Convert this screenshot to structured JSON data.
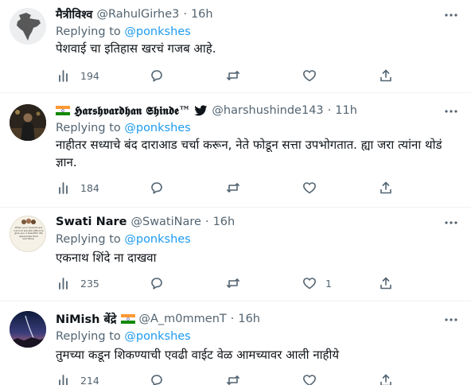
{
  "tweets": [
    {
      "display_name": "मैत्रीविश्व",
      "handle": "@RahulGirhe3",
      "separator": "·",
      "time": "16h",
      "replying_prefix": "Replying to",
      "replying_to": "@ponkshes",
      "text": "पेशवाई चा इतिहास खरचं गजब आहे.",
      "stats": {
        "replies": "",
        "retweets": "",
        "likes": "",
        "views": "194"
      }
    },
    {
      "display_name": "𝕳𝖆𝖗𝖘𝖍𝖛𝖆𝖗𝖉𝖍𝖆𝖓 𝕾𝖍𝖎𝖓𝖉𝖊™",
      "handle": "@harshushinde143",
      "separator": "·",
      "time": "11h",
      "replying_prefix": "Replying to",
      "replying_to": "@ponkshes",
      "text": "नाहीतर सध्याचे बंद दाराआड चर्चा करून, नेते फोडून सत्ता उपभोगतात. ह्या जरा त्यांना थोडं ज्ञान.",
      "stats": {
        "replies": "",
        "retweets": "",
        "likes": "",
        "views": "184"
      }
    },
    {
      "display_name": "Swati Nare",
      "handle": "@SwatiNare",
      "separator": "·",
      "time": "16h",
      "replying_prefix": "Replying to",
      "replying_to": "@ponkshes",
      "text": "एकनाथ शिंदे ना दाखवा",
      "avatar_text": "When your parents are not rich but still afford to give you a beautiful life Appreciate their sacrifices.",
      "stats": {
        "replies": "",
        "retweets": "",
        "likes": "1",
        "views": "235"
      }
    },
    {
      "display_name": "NiMish बेंद्रे",
      "handle": "@A_m0mmenT",
      "separator": "·",
      "time": "16h",
      "replying_prefix": "Replying to",
      "replying_to": "@ponkshes",
      "text": "तुमच्या कडून शिकण्याची एवढी वाईट वेळ आमच्यावर आली नाहीये",
      "stats": {
        "replies": "",
        "retweets": "",
        "likes": "",
        "views": "214"
      }
    }
  ],
  "icons": {
    "more": "more-horizontal-icon",
    "views": "analytics-bars-icon",
    "reply": "reply-bubble-icon",
    "retweet": "retweet-arrows-icon",
    "like": "heart-icon",
    "share": "share-upload-icon",
    "flag": "india-flag-icon",
    "verified": "verified-badge-icon"
  },
  "colors": {
    "text": "#0f1419",
    "muted": "#536471",
    "link": "#1d9bf0",
    "divider": "#eff3f4",
    "flag_saffron": "#ff9933",
    "flag_green": "#138808",
    "flag_chakra": "#000080"
  }
}
